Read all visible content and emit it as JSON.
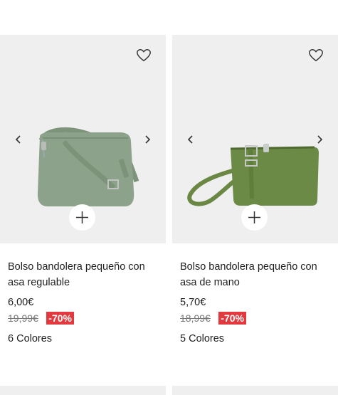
{
  "products": [
    {
      "name": "Bolso bandolera pequeño con asa regulable",
      "price": "6,00€",
      "old_price": "19,99€",
      "discount": "-70%",
      "colors_label": "6 Colores",
      "bag_color": "#8da28a",
      "icons": [
        "heart-icon",
        "chevron-left-icon",
        "chevron-right-icon",
        "plus-icon"
      ]
    },
    {
      "name": "Bolso bandolera pequeño con asa de mano",
      "price": "5,70€",
      "old_price": "18,99€",
      "discount": "-70%",
      "colors_label": "5 Colores",
      "bag_color": "#6b8a45",
      "icons": [
        "heart-icon",
        "chevron-left-icon",
        "chevron-right-icon",
        "plus-icon"
      ]
    }
  ],
  "colors": {
    "image_bg": "#efefef",
    "discount_bg": "#e0393e",
    "text": "#1e1e1e",
    "old_price": "#777777"
  }
}
